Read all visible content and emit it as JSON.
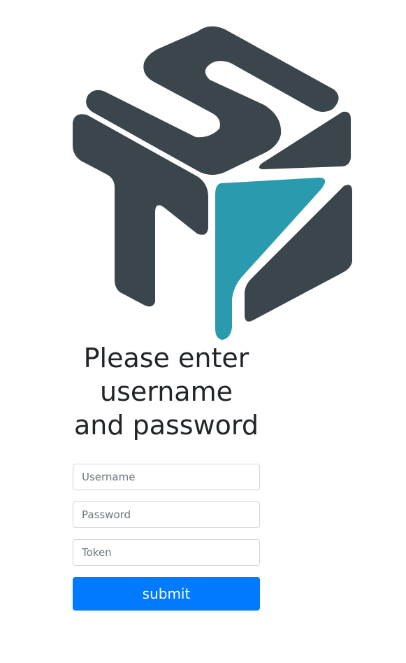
{
  "colors": {
    "logo_dark": "#3a464c",
    "logo_teal": "#2a9aae",
    "button": "#007bff",
    "button_text": "#ffffff"
  },
  "logo": {
    "icon": "sti-cube-logo-icon"
  },
  "login": {
    "heading": "Please enter username and password",
    "username_placeholder": "Username",
    "password_placeholder": "Password",
    "token_placeholder": "Token",
    "submit_label": "submit"
  }
}
